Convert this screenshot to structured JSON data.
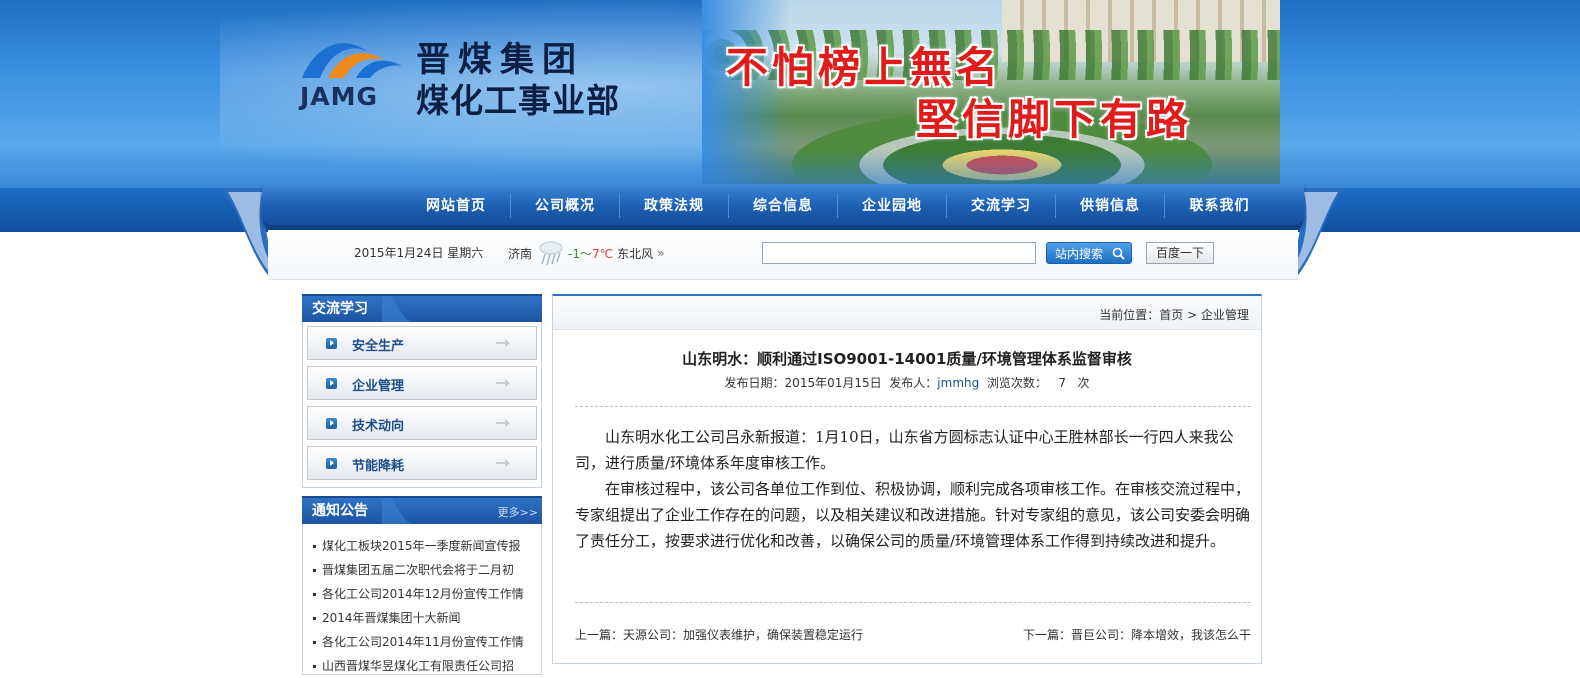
{
  "header": {
    "logo_mark_text": "JAMG",
    "company_name": "晋煤集团",
    "division_name": "煤化工事业部",
    "slogan_line1": "不怕榜上無名",
    "slogan_line2": "堅信脚下有路"
  },
  "nav": {
    "items": [
      {
        "label": "网站首页"
      },
      {
        "label": "公司概况"
      },
      {
        "label": "政策法规"
      },
      {
        "label": "综合信息"
      },
      {
        "label": "企业园地"
      },
      {
        "label": "交流学习"
      },
      {
        "label": "供销信息"
      },
      {
        "label": "联系我们"
      }
    ]
  },
  "toolbar": {
    "date": "2015年1月24日 星期六",
    "weather": {
      "city": "济南",
      "icon": "rain-icon",
      "temp_low": "-1",
      "temp_sep": "～",
      "temp_high": "7℃",
      "wind": "东北风",
      "more": "»"
    },
    "search_value": "",
    "site_search_label": "站内搜索",
    "baidu_label": "百度一下"
  },
  "sidebar": {
    "study": {
      "title": "交流学习",
      "items": [
        {
          "label": "安全生产"
        },
        {
          "label": "企业管理"
        },
        {
          "label": "技术动向"
        },
        {
          "label": "节能降耗"
        }
      ]
    },
    "notices": {
      "title": "通知公告",
      "more": "更多>>",
      "items": [
        {
          "text": "煤化工板块2015年一季度新闻宣传报"
        },
        {
          "text": "晋煤集团五届二次职代会将于二月初"
        },
        {
          "text": "各化工公司2014年12月份宣传工作情"
        },
        {
          "text": "2014年晋煤集团十大新闻"
        },
        {
          "text": "各化工公司2014年11月份宣传工作情"
        },
        {
          "text": "山西晋煤华昱煤化工有限责任公司招"
        }
      ]
    }
  },
  "breadcrumb": {
    "prefix": "当前位置：",
    "home": "首页",
    "sep": " > ",
    "current": "企业管理"
  },
  "article": {
    "title": "山东明水：顺利通过ISO9001-14001质量/环境管理体系监督审核",
    "date_label": "发布日期：",
    "date": "2015年01月15日",
    "author_label": "发布人：",
    "author": "jmmhg",
    "views_label": "浏览次数：",
    "views": "7",
    "views_unit": "次",
    "paragraphs": [
      "山东明水化工公司吕永新报道：1月10日，山东省方圆标志认证中心王胜林部长一行四人来我公司，进行质量/环境体系年度审核工作。",
      "在审核过程中，该公司各单位工作到位、积极协调，顺利完成各项审核工作。在审核交流过程中，专家组提出了企业工作存在的问题，以及相关建议和改进措施。针对专家组的意见，该公司安委会明确了责任分工，按要求进行优化和改善，以确保公司的质量/环境管理体系工作得到持续改进和提升。"
    ],
    "prev_label": "上一篇：",
    "prev_title": "天源公司：加强仪表维护，确保装置稳定运行",
    "next_label": "下一篇：",
    "next_title": "晋巨公司：降本增效，我该怎么干"
  }
}
